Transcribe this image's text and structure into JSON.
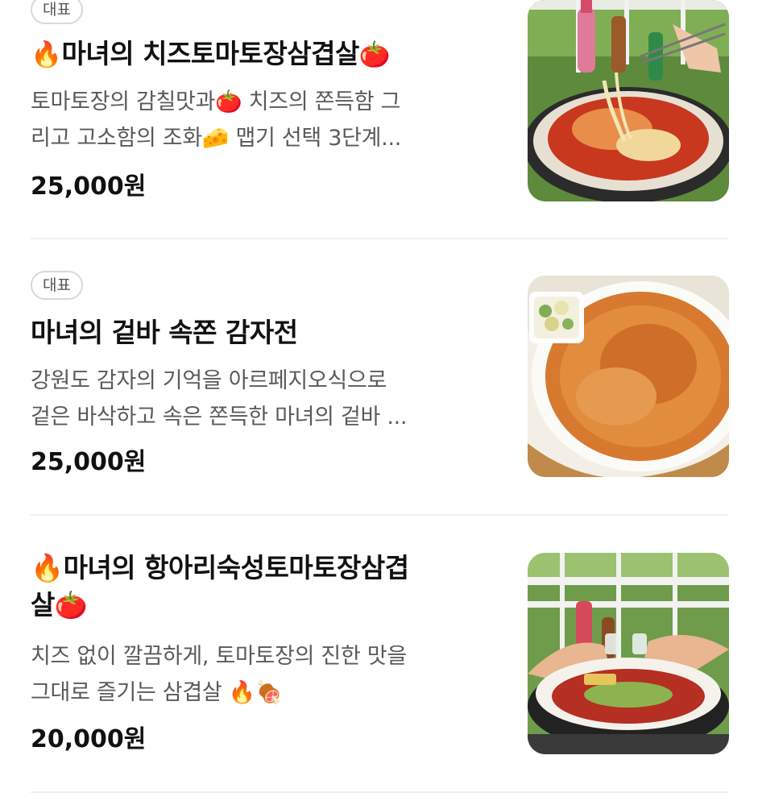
{
  "items": [
    {
      "badge": "대표",
      "title_prefix": "🔥",
      "title": "마녀의 치즈토마토장삼겹살",
      "title_suffix": "🍅",
      "desc_line1": "토마토장의 감칠맛과🍅 치즈의 쫀득함 그",
      "desc_line2": "리고 고소함의 조화🧀 맵기 선택 3단계...",
      "price": "25,000원"
    },
    {
      "badge": "대표",
      "title": "마녀의 겉바 속쫀 감자전",
      "desc_line1": "강원도 감자의 기억을 아르페지오식으로",
      "desc_line2": "겉은 바삭하고 속은 쫀득한 마녀의 겉바 ...",
      "price": "25,000원"
    },
    {
      "title_line1": "🔥마녀의 항아리숙성토마토장삼겹",
      "title_line2": "살🍅",
      "desc_line1": "치즈 없이 깔끔하게, 토마토장의 진한 맛을",
      "desc_line2": "그대로 즐기는 삼겹살 🔥🍖",
      "price": "20,000원"
    }
  ]
}
